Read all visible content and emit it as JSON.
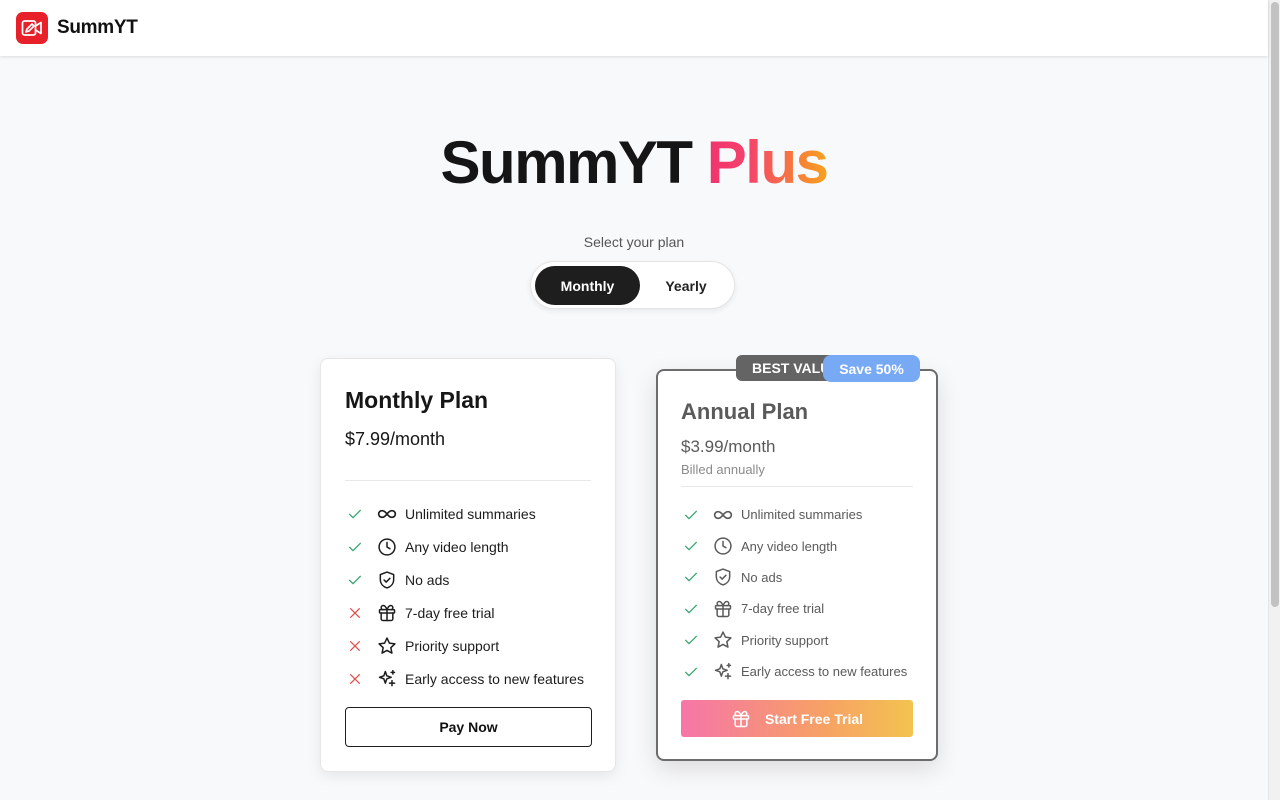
{
  "header": {
    "brand": "SummYT",
    "logo_icon": "video-edit-icon",
    "logo_color": "#e8202a"
  },
  "hero": {
    "title_main": "SummYT",
    "title_accent": "Plus",
    "select_label": "Select your plan"
  },
  "billing_toggle": {
    "options": [
      "Monthly",
      "Yearly"
    ],
    "selected": "Monthly"
  },
  "monthly_plan": {
    "name": "Monthly Plan",
    "price": "$7.99/month",
    "features": [
      {
        "label": "Unlimited summaries",
        "icon": "infinity-icon",
        "included": true
      },
      {
        "label": "Any video length",
        "icon": "clock-icon",
        "included": true
      },
      {
        "label": "No ads",
        "icon": "shield-check-icon",
        "included": true
      },
      {
        "label": "7-day free trial",
        "icon": "gift-icon",
        "included": false
      },
      {
        "label": "Priority support",
        "icon": "star-icon",
        "included": false
      },
      {
        "label": "Early access to new features",
        "icon": "sparkles-icon",
        "included": false
      }
    ],
    "button_label": "Pay Now"
  },
  "annual_plan": {
    "badge_best": "BEST VALUE",
    "badge_save": "Save 50%",
    "name": "Annual Plan",
    "price": "$3.99/month",
    "billed": "Billed annually",
    "features": [
      {
        "label": "Unlimited summaries",
        "icon": "infinity-icon",
        "included": true
      },
      {
        "label": "Any video length",
        "icon": "clock-icon",
        "included": true
      },
      {
        "label": "No ads",
        "icon": "shield-check-icon",
        "included": true
      },
      {
        "label": "7-day free trial",
        "icon": "gift-icon",
        "included": true
      },
      {
        "label": "Priority support",
        "icon": "star-icon",
        "included": true
      },
      {
        "label": "Early access to new features",
        "icon": "sparkles-icon",
        "included": true
      }
    ],
    "button_label": "Start Free Trial"
  },
  "colors": {
    "check": "#3aa571",
    "cross": "#e0524f",
    "accent_gradient_start": "#f0336f",
    "accent_gradient_end": "#f7a21e",
    "save_badge": "#78a9f5"
  }
}
